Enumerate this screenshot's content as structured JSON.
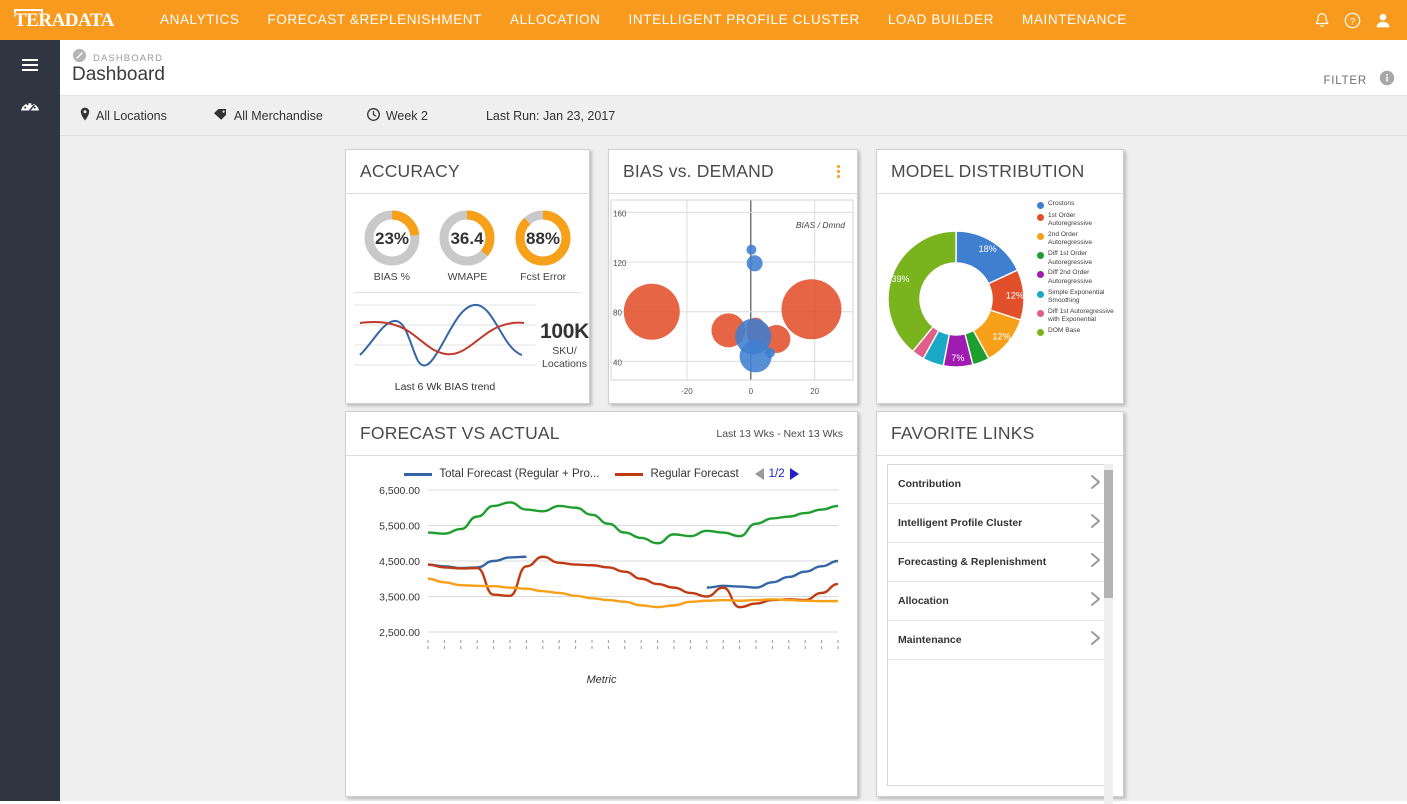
{
  "topnav": {
    "brand": "TERADATA",
    "links": [
      "ANALYTICS",
      "FORECAST &REPLENISHMENT",
      "ALLOCATION",
      "INTELLIGENT PROFILE CLUSTER",
      "LOAD BUILDER",
      "MAINTENANCE"
    ],
    "icons": [
      "bell-icon",
      "help-icon",
      "user-icon"
    ],
    "bg_color": "#f79a1e"
  },
  "sidebar": {
    "icons": [
      "hamburger-icon",
      "dashboard-gauge-icon"
    ],
    "bg_color": "#2f3541"
  },
  "header": {
    "breadcrumb": "DASHBOARD",
    "title": "Dashboard",
    "filter_label": "FILTER",
    "info_icon": "info-icon"
  },
  "filterbar": {
    "location": "All Locations",
    "merchandise": "All Merchandise",
    "period": "Week 2",
    "last_run": "Last Run: Jan 23, 2017"
  },
  "accuracy": {
    "title": "ACCURACY",
    "gauges": [
      {
        "value": "23%",
        "label": "BIAS %",
        "pct": 23
      },
      {
        "value": "36.4",
        "label": "WMAPE",
        "pct": 36.4
      },
      {
        "value": "88%",
        "label": "Fcst Error",
        "pct": 88
      }
    ],
    "sku_number": "100K",
    "sku_label_line1": "SKU/",
    "sku_label_line2": "Locations",
    "spark_label": "Last 6 Wk BIAS trend",
    "spark_colors": {
      "blue": "#3465a4",
      "red": "#c0392b"
    },
    "accent_color": "#f7a11a",
    "track_color": "#c9c9c9"
  },
  "bias": {
    "title": "BIAS vs. DEMAND",
    "menu_icon": "kebab-menu-icon",
    "watermark": "BIAS / Dmnd",
    "chart_data": {
      "type": "scatter",
      "title": "BIAS vs. DEMAND",
      "xlabel": "",
      "ylabel": "",
      "xticks": [
        "-20",
        "0",
        "20"
      ],
      "yticks": [
        "160",
        "120",
        "80",
        "40"
      ],
      "xlim": [
        -35,
        32
      ],
      "ylim": [
        25,
        170
      ],
      "grid": true,
      "series": [
        {
          "name": "orange-bubbles",
          "color": "#e2502b",
          "points": [
            {
              "x": -31,
              "y": 80,
              "r": 28
            },
            {
              "x": -7,
              "y": 65,
              "r": 17
            },
            {
              "x": 1.5,
              "y": 68,
              "r": 9
            },
            {
              "x": 2.5,
              "y": 62,
              "r": 12
            },
            {
              "x": 8,
              "y": 58,
              "r": 14
            },
            {
              "x": 19,
              "y": 82,
              "r": 30
            }
          ]
        },
        {
          "name": "blue-bubbles",
          "color": "#3f7fd0",
          "points": [
            {
              "x": 0.2,
              "y": 130,
              "r": 5
            },
            {
              "x": 1.2,
              "y": 119,
              "r": 8
            },
            {
              "x": 0.8,
              "y": 60,
              "r": 18
            },
            {
              "x": 1.5,
              "y": 44,
              "r": 16
            },
            {
              "x": 6,
              "y": 47,
              "r": 5
            }
          ]
        }
      ]
    }
  },
  "model": {
    "title": "MODEL DISTRIBUTION",
    "chart_data": {
      "type": "pie",
      "title": "MODEL DISTRIBUTION",
      "legend_position": "right",
      "labels": [
        "Crostons",
        "1st Order Autoregressive",
        "2nd Order Autoregressive",
        "Diff 1st Order Autoregressive",
        "Diff 2nd Order Autoregressive",
        "Simple Exponential Smoothing",
        "Diff 1st Autoregressive with Exponential",
        "DOM Base"
      ],
      "values": [
        18,
        12,
        12,
        4,
        7,
        5,
        3,
        39
      ],
      "display_labels": [
        "18%",
        "12%",
        "12%",
        "",
        "7%",
        "",
        "",
        "39%"
      ],
      "colors": [
        "#3f7fd0",
        "#e2502b",
        "#f7a11a",
        "#1e9e2e",
        "#a01bb0",
        "#1aa9c4",
        "#e35d8a",
        "#79b41e"
      ]
    }
  },
  "forecast": {
    "title": "FORECAST VS ACTUAL",
    "subtitle": "Last 13 Wks - Next 13 Wks",
    "legend": [
      {
        "label": "Total Forecast (Regular + Pro...",
        "color": "#3465a4"
      },
      {
        "label": "Regular Forecast",
        "color": "#bf3b14"
      }
    ],
    "pager": {
      "prev_icon": "prev-arrow-icon",
      "text": "1/2",
      "next_icon": "next-arrow-icon"
    },
    "axis_label": "Metric",
    "chart_data": {
      "type": "line",
      "title": "FORECAST VS ACTUAL",
      "xlabel": "Metric",
      "ylabel": "",
      "yticks": [
        "2,500.00",
        "3,500.00",
        "4,500.00",
        "5,500.00",
        "6,500.00"
      ],
      "ylim": [
        2500,
        6500
      ],
      "grid": true,
      "x": [
        1,
        2,
        3,
        4,
        5,
        6,
        7,
        8,
        9,
        10,
        11,
        12,
        13,
        14,
        15,
        16,
        17,
        18,
        19,
        20,
        21,
        22,
        23,
        24,
        25,
        26
      ],
      "series": [
        {
          "name": "green-series",
          "color": "#1e9e2e",
          "values": [
            5300,
            5270,
            5400,
            5750,
            6050,
            6150,
            5950,
            5900,
            6050,
            6000,
            5800,
            5550,
            5300,
            5150,
            5000,
            5250,
            5200,
            5350,
            5300,
            5200,
            5550,
            5700,
            5750,
            5850,
            5950,
            6050
          ]
        },
        {
          "name": "blue-series",
          "color": "#3465a4",
          "values": [
            4400,
            4350,
            4300,
            4320,
            4500,
            4600,
            4620,
            null,
            null,
            null,
            null,
            null,
            null,
            null,
            null,
            null,
            null,
            3750,
            3800,
            3780,
            3750,
            3900,
            4050,
            4200,
            4350,
            4500
          ]
        },
        {
          "name": "red-series",
          "color": "#bf3b14",
          "values": [
            4400,
            4320,
            4290,
            4300,
            3550,
            3520,
            4350,
            4620,
            4450,
            4400,
            4380,
            4320,
            4200,
            4000,
            3850,
            3750,
            3600,
            3500,
            3750,
            3200,
            3300,
            3400,
            3420,
            3400,
            3600,
            3850
          ]
        },
        {
          "name": "orange-series",
          "color": "#f7a11a",
          "values": [
            4000,
            3900,
            3820,
            3800,
            3790,
            3750,
            3720,
            3650,
            3600,
            3520,
            3450,
            3400,
            3350,
            3250,
            3200,
            3250,
            3350,
            3380,
            3400,
            3380,
            3400,
            3420,
            3400,
            3380,
            3370,
            3370
          ]
        }
      ]
    }
  },
  "links": {
    "title": "FAVORITE LINKS",
    "items": [
      "Contribution",
      "Intelligent Profile Cluster",
      "Forecasting & Replenishment",
      "Allocation",
      "Maintenance"
    ],
    "chevron_icon": "chevron-right-icon"
  }
}
